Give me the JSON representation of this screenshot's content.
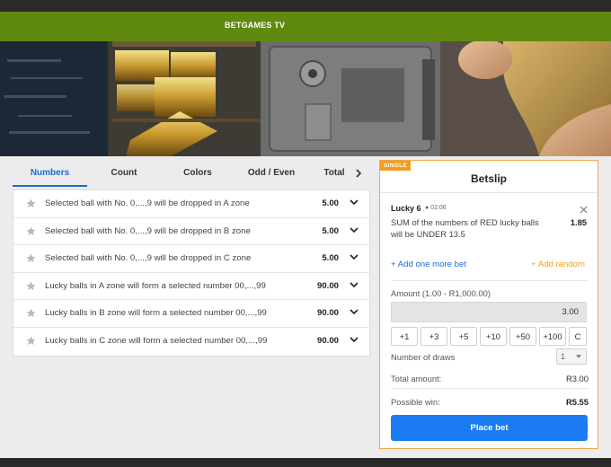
{
  "header": {
    "brand": "BETGAMES TV"
  },
  "tabs": [
    {
      "label": "Numbers",
      "active": true
    },
    {
      "label": "Count",
      "active": false
    },
    {
      "label": "Colors",
      "active": false
    },
    {
      "label": "Odd / Even",
      "active": false
    },
    {
      "label": "Total",
      "active": false
    }
  ],
  "bets": [
    {
      "text": "Selected ball with No. 0,...,9 will be dropped in A zone",
      "odds": "5.00"
    },
    {
      "text": "Selected ball with No. 0,...,9 will be dropped in B zone",
      "odds": "5.00"
    },
    {
      "text": "Selected ball with No. 0,...,9 will be dropped in C zone",
      "odds": "5.00"
    },
    {
      "text": "Lucky balls in A zone will form a selected number 00,...,99",
      "odds": "90.00"
    },
    {
      "text": "Lucky balls in B zone will form a selected number 00,...,99",
      "odds": "90.00"
    },
    {
      "text": "Lucky balls in C zone will form a selected number 00,...,99",
      "odds": "90.00"
    }
  ],
  "betslip": {
    "badge": "SINGLE",
    "title": "Betslip",
    "game": "Lucky 6",
    "time": "● 02:06",
    "description": "SUM of the numbers of RED lucky balls will be UNDER 13.5",
    "odds": "1.85",
    "add_more": "+ Add one more bet",
    "add_random": "+ Add random",
    "amount_label": "Amount (1.00 - R1,000.00)",
    "amount_value": "3.00",
    "quick": [
      "+1",
      "+3",
      "+5",
      "+10",
      "+50",
      "+100",
      "C"
    ],
    "draws_label": "Number of draws",
    "draws_value": "1",
    "total_label": "Total amount:",
    "total_value": "R3.00",
    "win_label": "Possible win:",
    "win_value": "R5.55",
    "place_bet": "Place bet"
  },
  "colors": {
    "brand_green": "#5f8a0f",
    "accent_blue": "#1a6bd1",
    "accent_orange": "#f39c1e"
  }
}
